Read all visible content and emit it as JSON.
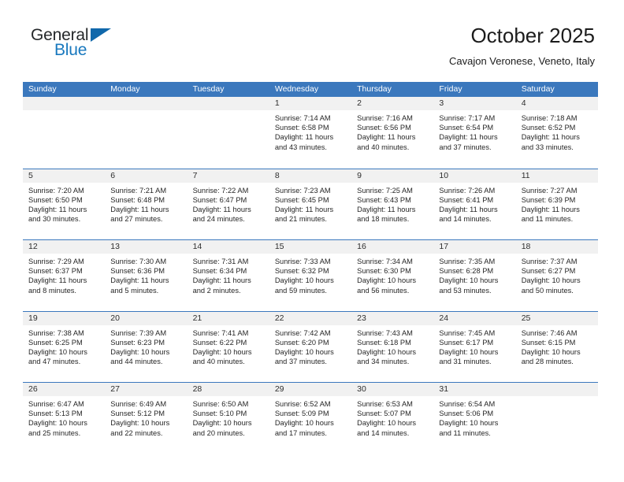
{
  "logo": {
    "word_top": "General",
    "word_bottom": "Blue",
    "triangle_color": "#1068ab",
    "blue_color": "#1878be"
  },
  "header": {
    "title": "October 2025",
    "subtitle": "Cavajon Veronese, Veneto, Italy"
  },
  "theme": {
    "header_blue": "#3b78bd",
    "day_band_gray": "#f1f1f1",
    "text_color": "#262626"
  },
  "weekday_headers": [
    "Sunday",
    "Monday",
    "Tuesday",
    "Wednesday",
    "Thursday",
    "Friday",
    "Saturday"
  ],
  "weeks": [
    [
      {
        "day": "",
        "sunrise": "",
        "sunset": "",
        "daylight_a": "",
        "daylight_b": ""
      },
      {
        "day": "",
        "sunrise": "",
        "sunset": "",
        "daylight_a": "",
        "daylight_b": ""
      },
      {
        "day": "",
        "sunrise": "",
        "sunset": "",
        "daylight_a": "",
        "daylight_b": ""
      },
      {
        "day": "1",
        "sunrise": "Sunrise: 7:14 AM",
        "sunset": "Sunset: 6:58 PM",
        "daylight_a": "Daylight: 11 hours",
        "daylight_b": "and 43 minutes."
      },
      {
        "day": "2",
        "sunrise": "Sunrise: 7:16 AM",
        "sunset": "Sunset: 6:56 PM",
        "daylight_a": "Daylight: 11 hours",
        "daylight_b": "and 40 minutes."
      },
      {
        "day": "3",
        "sunrise": "Sunrise: 7:17 AM",
        "sunset": "Sunset: 6:54 PM",
        "daylight_a": "Daylight: 11 hours",
        "daylight_b": "and 37 minutes."
      },
      {
        "day": "4",
        "sunrise": "Sunrise: 7:18 AM",
        "sunset": "Sunset: 6:52 PM",
        "daylight_a": "Daylight: 11 hours",
        "daylight_b": "and 33 minutes."
      }
    ],
    [
      {
        "day": "5",
        "sunrise": "Sunrise: 7:20 AM",
        "sunset": "Sunset: 6:50 PM",
        "daylight_a": "Daylight: 11 hours",
        "daylight_b": "and 30 minutes."
      },
      {
        "day": "6",
        "sunrise": "Sunrise: 7:21 AM",
        "sunset": "Sunset: 6:48 PM",
        "daylight_a": "Daylight: 11 hours",
        "daylight_b": "and 27 minutes."
      },
      {
        "day": "7",
        "sunrise": "Sunrise: 7:22 AM",
        "sunset": "Sunset: 6:47 PM",
        "daylight_a": "Daylight: 11 hours",
        "daylight_b": "and 24 minutes."
      },
      {
        "day": "8",
        "sunrise": "Sunrise: 7:23 AM",
        "sunset": "Sunset: 6:45 PM",
        "daylight_a": "Daylight: 11 hours",
        "daylight_b": "and 21 minutes."
      },
      {
        "day": "9",
        "sunrise": "Sunrise: 7:25 AM",
        "sunset": "Sunset: 6:43 PM",
        "daylight_a": "Daylight: 11 hours",
        "daylight_b": "and 18 minutes."
      },
      {
        "day": "10",
        "sunrise": "Sunrise: 7:26 AM",
        "sunset": "Sunset: 6:41 PM",
        "daylight_a": "Daylight: 11 hours",
        "daylight_b": "and 14 minutes."
      },
      {
        "day": "11",
        "sunrise": "Sunrise: 7:27 AM",
        "sunset": "Sunset: 6:39 PM",
        "daylight_a": "Daylight: 11 hours",
        "daylight_b": "and 11 minutes."
      }
    ],
    [
      {
        "day": "12",
        "sunrise": "Sunrise: 7:29 AM",
        "sunset": "Sunset: 6:37 PM",
        "daylight_a": "Daylight: 11 hours",
        "daylight_b": "and 8 minutes."
      },
      {
        "day": "13",
        "sunrise": "Sunrise: 7:30 AM",
        "sunset": "Sunset: 6:36 PM",
        "daylight_a": "Daylight: 11 hours",
        "daylight_b": "and 5 minutes."
      },
      {
        "day": "14",
        "sunrise": "Sunrise: 7:31 AM",
        "sunset": "Sunset: 6:34 PM",
        "daylight_a": "Daylight: 11 hours",
        "daylight_b": "and 2 minutes."
      },
      {
        "day": "15",
        "sunrise": "Sunrise: 7:33 AM",
        "sunset": "Sunset: 6:32 PM",
        "daylight_a": "Daylight: 10 hours",
        "daylight_b": "and 59 minutes."
      },
      {
        "day": "16",
        "sunrise": "Sunrise: 7:34 AM",
        "sunset": "Sunset: 6:30 PM",
        "daylight_a": "Daylight: 10 hours",
        "daylight_b": "and 56 minutes."
      },
      {
        "day": "17",
        "sunrise": "Sunrise: 7:35 AM",
        "sunset": "Sunset: 6:28 PM",
        "daylight_a": "Daylight: 10 hours",
        "daylight_b": "and 53 minutes."
      },
      {
        "day": "18",
        "sunrise": "Sunrise: 7:37 AM",
        "sunset": "Sunset: 6:27 PM",
        "daylight_a": "Daylight: 10 hours",
        "daylight_b": "and 50 minutes."
      }
    ],
    [
      {
        "day": "19",
        "sunrise": "Sunrise: 7:38 AM",
        "sunset": "Sunset: 6:25 PM",
        "daylight_a": "Daylight: 10 hours",
        "daylight_b": "and 47 minutes."
      },
      {
        "day": "20",
        "sunrise": "Sunrise: 7:39 AM",
        "sunset": "Sunset: 6:23 PM",
        "daylight_a": "Daylight: 10 hours",
        "daylight_b": "and 44 minutes."
      },
      {
        "day": "21",
        "sunrise": "Sunrise: 7:41 AM",
        "sunset": "Sunset: 6:22 PM",
        "daylight_a": "Daylight: 10 hours",
        "daylight_b": "and 40 minutes."
      },
      {
        "day": "22",
        "sunrise": "Sunrise: 7:42 AM",
        "sunset": "Sunset: 6:20 PM",
        "daylight_a": "Daylight: 10 hours",
        "daylight_b": "and 37 minutes."
      },
      {
        "day": "23",
        "sunrise": "Sunrise: 7:43 AM",
        "sunset": "Sunset: 6:18 PM",
        "daylight_a": "Daylight: 10 hours",
        "daylight_b": "and 34 minutes."
      },
      {
        "day": "24",
        "sunrise": "Sunrise: 7:45 AM",
        "sunset": "Sunset: 6:17 PM",
        "daylight_a": "Daylight: 10 hours",
        "daylight_b": "and 31 minutes."
      },
      {
        "day": "25",
        "sunrise": "Sunrise: 7:46 AM",
        "sunset": "Sunset: 6:15 PM",
        "daylight_a": "Daylight: 10 hours",
        "daylight_b": "and 28 minutes."
      }
    ],
    [
      {
        "day": "26",
        "sunrise": "Sunrise: 6:47 AM",
        "sunset": "Sunset: 5:13 PM",
        "daylight_a": "Daylight: 10 hours",
        "daylight_b": "and 25 minutes."
      },
      {
        "day": "27",
        "sunrise": "Sunrise: 6:49 AM",
        "sunset": "Sunset: 5:12 PM",
        "daylight_a": "Daylight: 10 hours",
        "daylight_b": "and 22 minutes."
      },
      {
        "day": "28",
        "sunrise": "Sunrise: 6:50 AM",
        "sunset": "Sunset: 5:10 PM",
        "daylight_a": "Daylight: 10 hours",
        "daylight_b": "and 20 minutes."
      },
      {
        "day": "29",
        "sunrise": "Sunrise: 6:52 AM",
        "sunset": "Sunset: 5:09 PM",
        "daylight_a": "Daylight: 10 hours",
        "daylight_b": "and 17 minutes."
      },
      {
        "day": "30",
        "sunrise": "Sunrise: 6:53 AM",
        "sunset": "Sunset: 5:07 PM",
        "daylight_a": "Daylight: 10 hours",
        "daylight_b": "and 14 minutes."
      },
      {
        "day": "31",
        "sunrise": "Sunrise: 6:54 AM",
        "sunset": "Sunset: 5:06 PM",
        "daylight_a": "Daylight: 10 hours",
        "daylight_b": "and 11 minutes."
      },
      {
        "day": "",
        "sunrise": "",
        "sunset": "",
        "daylight_a": "",
        "daylight_b": ""
      }
    ]
  ]
}
